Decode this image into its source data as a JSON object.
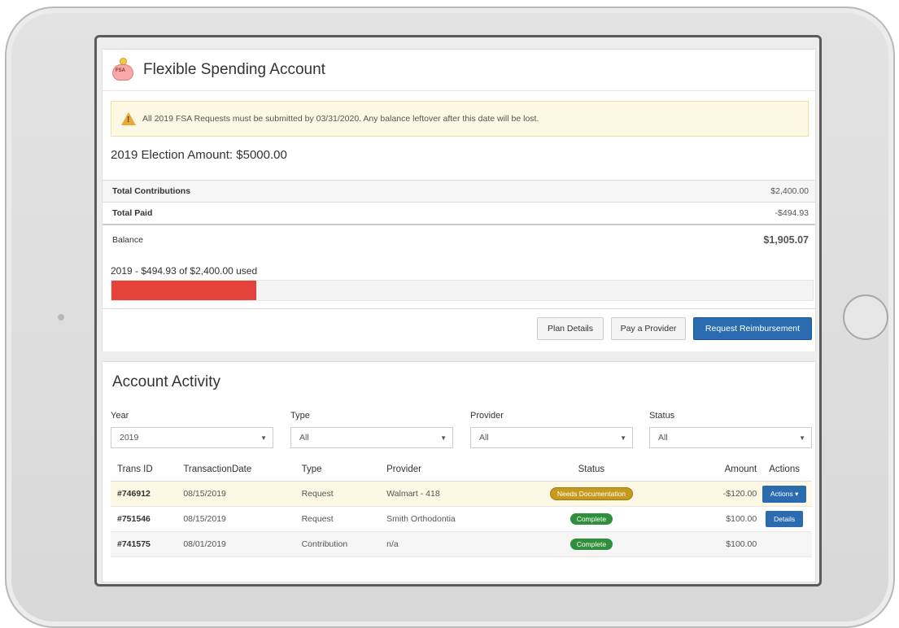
{
  "app": {
    "title": "Flexible Spending Account",
    "icon": "piggy-bank-icon",
    "icon_label": "FSA",
    "colors": {
      "primary": "#2b6cb0",
      "progress": "#e4433b",
      "alert_bg": "#fcf8e3",
      "badge_warning": "#c79a1f",
      "badge_success": "#2f8f3a"
    }
  },
  "alert": {
    "icon": "warning-icon",
    "text": "All 2019 FSA Requests must be submitted by 03/31/2020. Any balance leftover after this date will be lost."
  },
  "election": {
    "heading": "2019 Election Amount: $5000.00"
  },
  "summary": {
    "rows": [
      {
        "label": "Total Contributions",
        "value": "$2,400.00"
      },
      {
        "label": "Total Paid",
        "value": "-$494.93"
      },
      {
        "label": "Balance",
        "value": "$1,905.07"
      }
    ]
  },
  "usage": {
    "text": "2019 - $494.93 of $2,400.00 used",
    "percent": 20.6
  },
  "buttons": {
    "plan_details": "Plan Details",
    "pay_provider": "Pay a Provider",
    "request_reimbursement": "Request Reimbursement"
  },
  "activity": {
    "title": "Account Activity",
    "filters": [
      {
        "label": "Year",
        "value": "2019"
      },
      {
        "label": "Type",
        "value": "All"
      },
      {
        "label": "Provider",
        "value": "All"
      },
      {
        "label": "Status",
        "value": "All"
      }
    ],
    "columns": [
      "Trans ID",
      "TransactionDate",
      "Type",
      "Provider",
      "Status",
      "Amount",
      "Actions"
    ],
    "rows": [
      {
        "id": "#746912",
        "date": "08/15/2019",
        "type": "Request",
        "provider": "Walmart - 418",
        "status": "Needs Documentation",
        "amount": "-$120.00",
        "action": "Actions ▾"
      },
      {
        "id": "#751546",
        "date": "08/15/2019",
        "type": "Request",
        "provider": "Smith Orthodontia",
        "status": "Complete",
        "amount": "$100.00",
        "action": "Details"
      },
      {
        "id": "#741575",
        "date": "08/01/2019",
        "type": "Contribution",
        "provider": "n/a",
        "status": "Complete",
        "amount": "$100.00",
        "action": ""
      }
    ]
  }
}
